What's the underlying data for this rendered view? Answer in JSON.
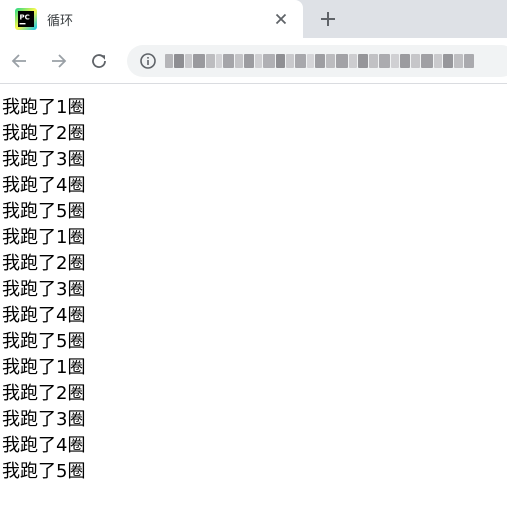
{
  "browser": {
    "tab": {
      "title": "循环",
      "favicon": "pycharm-icon"
    },
    "new_tab_icon": "plus-icon",
    "close_icon": "close-icon",
    "toolbar": {
      "back_icon": "arrow-left-icon",
      "forward_icon": "arrow-right-icon",
      "reload_icon": "reload-icon",
      "site_info_icon": "info-icon"
    }
  },
  "page": {
    "lines": [
      "我跑了1圈",
      "我跑了2圈",
      "我跑了3圈",
      "我跑了4圈",
      "我跑了5圈",
      "我跑了1圈",
      "我跑了2圈",
      "我跑了3圈",
      "我跑了4圈",
      "我跑了5圈",
      "我跑了1圈",
      "我跑了2圈",
      "我跑了3圈",
      "我跑了4圈",
      "我跑了5圈"
    ]
  },
  "colors": {
    "tabstrip_bg": "#dee1e6",
    "omnibox_bg": "#f1f3f4",
    "icon_gray": "#5f6368",
    "text": "#000000"
  }
}
